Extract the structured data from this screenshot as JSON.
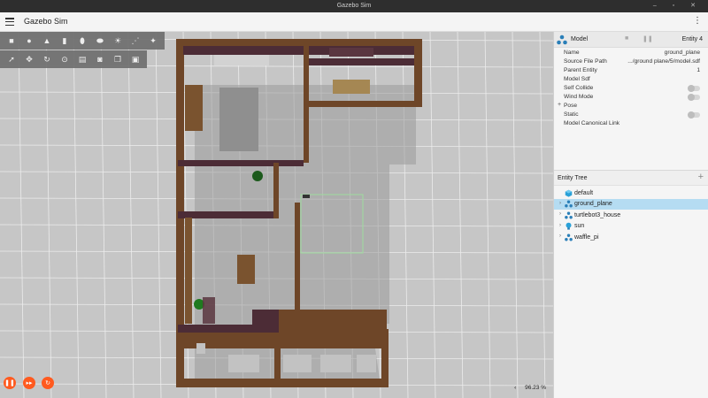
{
  "window": {
    "title": "Gazebo Sim",
    "controls": "–  ▫  ✕"
  },
  "header": {
    "app_title": "Gazebo Sim"
  },
  "toolbar_top": [
    {
      "icon": "box-shape-icon",
      "glyph": "■"
    },
    {
      "icon": "sphere-shape-icon",
      "glyph": "●"
    },
    {
      "icon": "cone-shape-icon",
      "glyph": "▲"
    },
    {
      "icon": "cylinder-shape-icon",
      "glyph": "▮"
    },
    {
      "icon": "capsule-shape-icon",
      "glyph": "⬮"
    },
    {
      "icon": "ellipsoid-shape-icon",
      "glyph": "⬬"
    },
    {
      "icon": "sun-light-icon",
      "glyph": "☀"
    },
    {
      "icon": "directional-light-icon",
      "glyph": "⋰"
    },
    {
      "icon": "spot-light-icon",
      "glyph": "✦"
    }
  ],
  "toolbar_second": [
    {
      "icon": "select-arrow-icon",
      "glyph": "➚"
    },
    {
      "icon": "translate-icon",
      "glyph": "✥"
    },
    {
      "icon": "rotate-icon",
      "glyph": "↻"
    },
    {
      "icon": "scale-icon",
      "glyph": "⊙"
    },
    {
      "icon": "screenshot-icon",
      "glyph": "▤"
    },
    {
      "icon": "camera-icon",
      "glyph": "◙"
    },
    {
      "icon": "copy-icon",
      "glyph": "❐"
    },
    {
      "icon": "paste-icon",
      "glyph": "▣"
    }
  ],
  "bottom_controls": {
    "play_pause_glyph": "❚❚",
    "step_glyph": "▸▸",
    "reset_glyph": "↻",
    "rtf_chevron": "‹",
    "real_time_factor": "96.23 %"
  },
  "component_inspector": {
    "title": "Model",
    "lock_glyph": "■",
    "pause_glyph": "❚❚",
    "entity_label": "Entity 4",
    "properties": [
      {
        "key": "Name",
        "value": "ground_plane"
      },
      {
        "key": "Source File Path",
        "value": ".../ground plane/5/model.sdf"
      },
      {
        "key": "Parent Entity",
        "value": "1"
      },
      {
        "key": "Model Sdf",
        "value": ""
      },
      {
        "key": "Self Collide",
        "value": ""
      },
      {
        "key": "Wind Mode",
        "value": ""
      },
      {
        "key": "Pose",
        "value": ""
      },
      {
        "key": "Static",
        "value": ""
      },
      {
        "key": "Model Canonical Link",
        "value": ""
      }
    ],
    "pose_expander": "+"
  },
  "entity_tree": {
    "title": "Entity Tree",
    "add_glyph": "+",
    "expand_glyph": "›",
    "items": [
      {
        "label": "default",
        "icon": "world-cube-icon",
        "selected": false,
        "expandable": false
      },
      {
        "label": "ground_plane",
        "icon": "model-icon",
        "selected": true,
        "expandable": true
      },
      {
        "label": "turtlebot3_house",
        "icon": "model-icon",
        "selected": false,
        "expandable": true
      },
      {
        "label": "sun",
        "icon": "light-bulb-icon",
        "selected": false,
        "expandable": true
      },
      {
        "label": "waffle_pi",
        "icon": "model-icon",
        "selected": false,
        "expandable": true
      }
    ]
  },
  "colors": {
    "accent_orange": "#ff5a1f",
    "selection_blue": "#b5dcf2",
    "wall_wood": "#6b4526",
    "wall_purple": "#4a2a35",
    "grid_line": "#f2f2f2"
  }
}
